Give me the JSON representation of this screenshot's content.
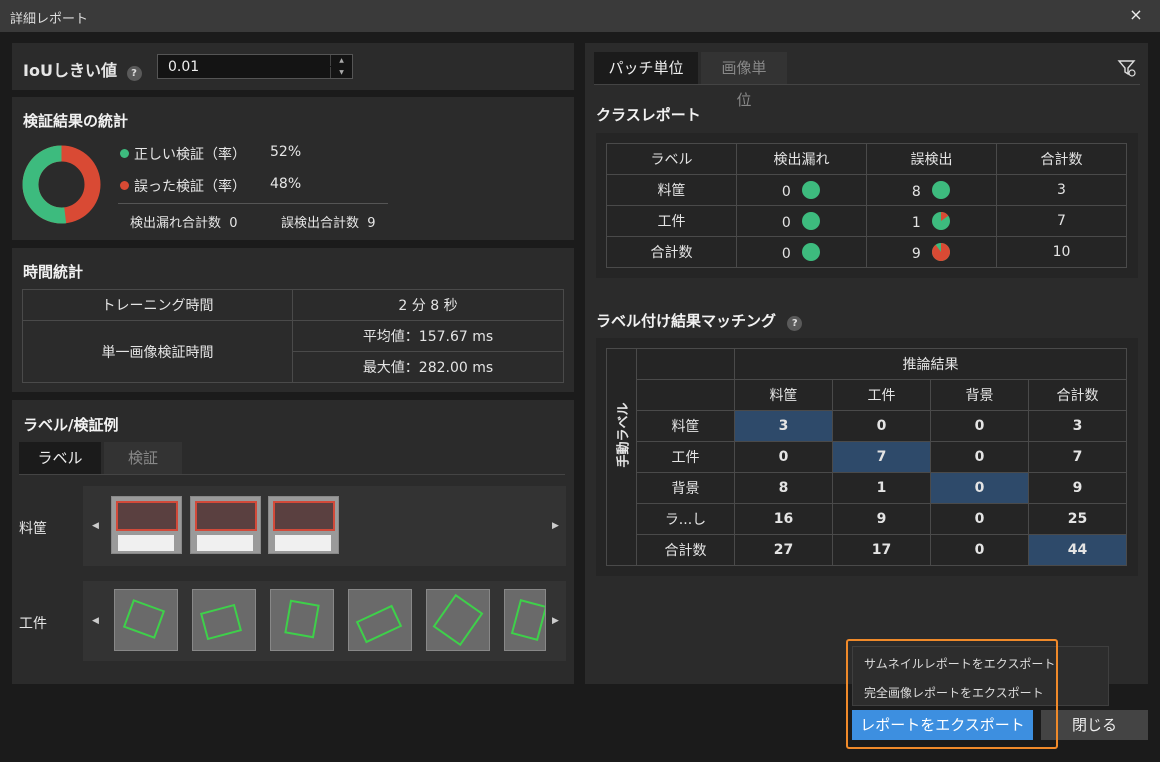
{
  "window": {
    "title": "詳細レポート",
    "close": "×"
  },
  "iou": {
    "label": "IoUしきい値",
    "value": "0.01"
  },
  "stats": {
    "title": "検証結果の統計",
    "correct": {
      "label": "正しい検証（率）",
      "value": "52%",
      "color": "#3dbb7e",
      "fraction": 0.52
    },
    "wrong": {
      "label": "誤った検証（率）",
      "value": "48%",
      "color": "#d94a34",
      "fraction": 0.48
    },
    "missed_total": "検出漏れ合計数  0",
    "false_total": "誤検出合計数  9"
  },
  "time": {
    "title": "時間統計",
    "training_label": "トレーニング時間",
    "training_value": "2 分 8 秒",
    "single_label": "単一画像検証時間",
    "avg": "平均値：157.67 ms",
    "max": "最大値：282.00 ms"
  },
  "examples": {
    "title": "ラベル/検証例",
    "tabs": [
      "ラベル",
      "検証"
    ],
    "rows": [
      "料筐",
      "工件"
    ]
  },
  "right": {
    "tabs": [
      "パッチ単位",
      "画像単位"
    ],
    "class_report": {
      "title": "クラスレポート",
      "headers": [
        "ラベル",
        "検出漏れ",
        "誤検出",
        "合計数"
      ],
      "rows": [
        {
          "label": "料筐",
          "missed": "0",
          "missed_frac": 0,
          "false": "8",
          "false_frac": 0,
          "total": "3"
        },
        {
          "label": "工件",
          "missed": "0",
          "missed_frac": 0,
          "false": "1",
          "false_frac": 0.15,
          "total": "7"
        },
        {
          "label": "合計数",
          "missed": "0",
          "missed_frac": 0,
          "false": "9",
          "false_frac": 0.9,
          "total": "10"
        }
      ]
    },
    "matching": {
      "title": "ラベル付け結果マッチング",
      "inference": "推論結果",
      "manual": "手動ラベル",
      "cols": [
        "料筐",
        "工件",
        "背景",
        "合計数"
      ],
      "rows": [
        {
          "label": "料筐",
          "vals": [
            "3",
            "0",
            "0",
            "3"
          ]
        },
        {
          "label": "工件",
          "vals": [
            "0",
            "7",
            "0",
            "7"
          ]
        },
        {
          "label": "背景",
          "vals": [
            "8",
            "1",
            "0",
            "9"
          ]
        },
        {
          "label": "ラ...し",
          "vals": [
            "16",
            "9",
            "0",
            "25"
          ]
        },
        {
          "label": "合計数",
          "vals": [
            "27",
            "17",
            "0",
            "44"
          ]
        }
      ]
    }
  },
  "export_menu": {
    "thumb": "サムネイルレポートをエクスポート",
    "full": "完全画像レポートをエクスポート"
  },
  "buttons": {
    "export": "レポートをエクスポート",
    "close": "閉じる"
  },
  "colors": {
    "accent": "#3d8fe0",
    "highlight": "#2e4a6a",
    "orange": "#f08a2a"
  }
}
